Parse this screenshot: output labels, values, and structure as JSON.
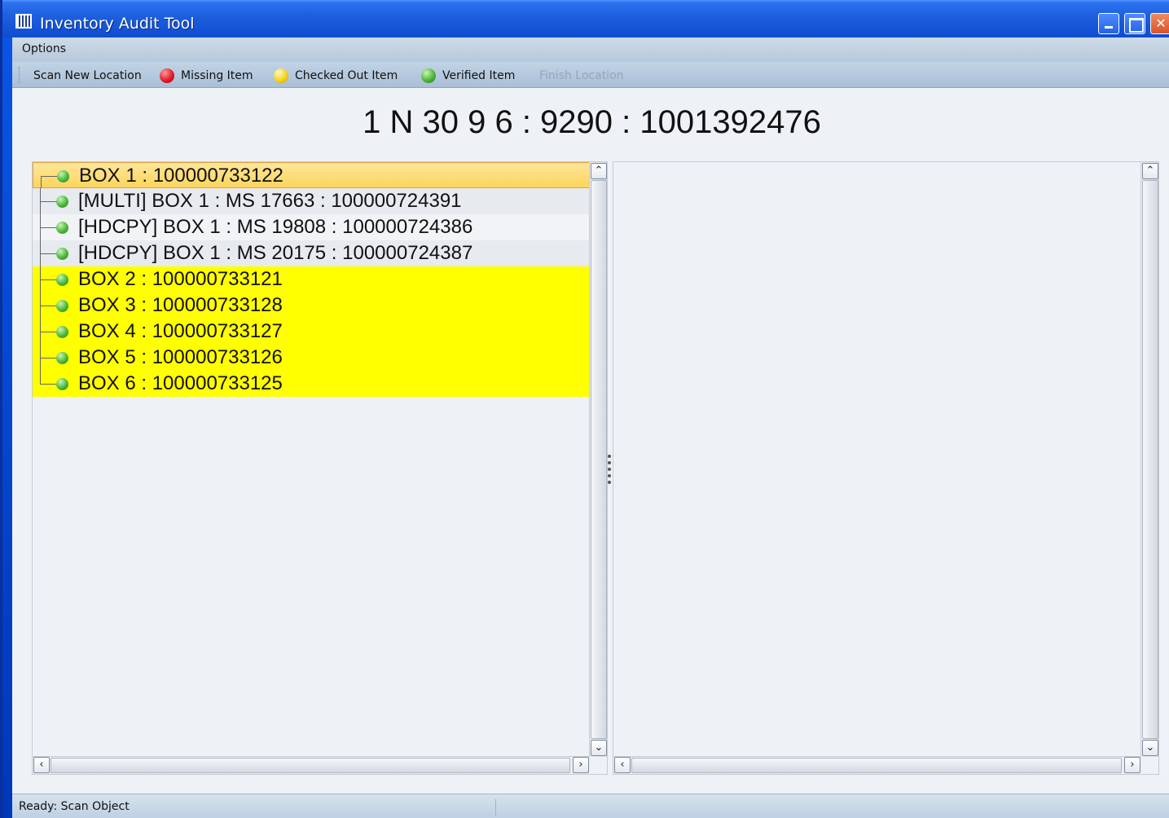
{
  "window": {
    "title": "Inventory Audit Tool"
  },
  "menu": {
    "options_label": "Options"
  },
  "toolbar": {
    "scan_new_location": "Scan New Location",
    "missing_item": "Missing Item",
    "checked_out_item": "Checked Out Item",
    "verified_item": "Verified Item",
    "finish_location": "Finish Location"
  },
  "location": {
    "title": "1 N 30 9 6 : 9290 : 1001392476"
  },
  "tree": {
    "items": [
      {
        "label": "BOX 1 : 100000733122",
        "status_color": "#4ab73a"
      },
      {
        "label": "[MULTI] BOX 1 : MS 17663 : 100000724391",
        "status_color": "#4ab73a"
      },
      {
        "label": "[HDCPY] BOX 1 : MS 19808 : 100000724386",
        "status_color": "#4ab73a"
      },
      {
        "label": "[HDCPY] BOX 1 : MS 20175 : 100000724387",
        "status_color": "#4ab73a"
      },
      {
        "label": "BOX 2 : 100000733121",
        "status_color": "#4ab73a"
      },
      {
        "label": "BOX 3 : 100000733128",
        "status_color": "#4ab73a"
      },
      {
        "label": "BOX 4 : 100000733127",
        "status_color": "#4ab73a"
      },
      {
        "label": "BOX 5 : 100000733126",
        "status_color": "#4ab73a"
      },
      {
        "label": "BOX 6 : 100000733125",
        "status_color": "#4ab73a"
      }
    ]
  },
  "status": {
    "text": "Ready: Scan Object"
  },
  "colors": {
    "selected_row": "#fcd55c",
    "highlight_row": "#ffff00",
    "missing": "#e11c2c",
    "checked_out": "#f6d21e",
    "verified": "#4ab73a"
  }
}
